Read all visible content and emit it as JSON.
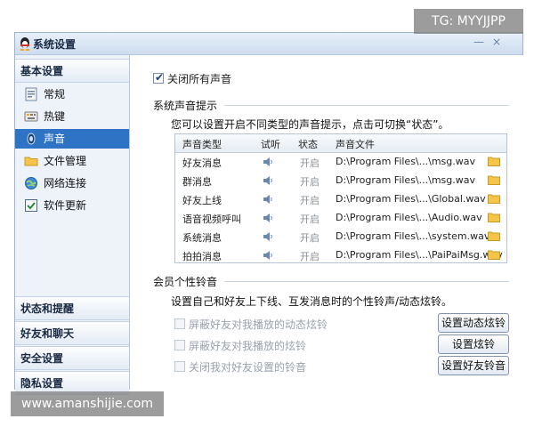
{
  "window": {
    "title": "系统设置"
  },
  "sidebar": {
    "sections": [
      {
        "label": "基本设置"
      },
      {
        "label": "状态和提醒"
      },
      {
        "label": "好友和聊天"
      },
      {
        "label": "安全设置"
      },
      {
        "label": "隐私设置"
      }
    ],
    "items": [
      {
        "label": "常规",
        "icon": "general-icon"
      },
      {
        "label": "热键",
        "icon": "hotkey-icon"
      },
      {
        "label": "声音",
        "icon": "sound-icon",
        "selected": true
      },
      {
        "label": "文件管理",
        "icon": "folder-icon"
      },
      {
        "label": "网络连接",
        "icon": "network-icon"
      },
      {
        "label": "软件更新",
        "icon": "update-icon"
      }
    ]
  },
  "content": {
    "mute_all": {
      "label": "关闭所有声音",
      "checked": true
    },
    "system_group": {
      "title": "系统声音提示",
      "description": "您可以设置开启不同类型的声音提示，点击可切换“状态”。"
    },
    "table": {
      "headers": [
        "声音类型",
        "试听",
        "状态",
        "声音文件"
      ],
      "rows": [
        {
          "type": "好友消息",
          "status": "开启",
          "file": "D:\\Program Files\\...\\msg.wav"
        },
        {
          "type": "群消息",
          "status": "开启",
          "file": "D:\\Program Files\\...\\msg.wav"
        },
        {
          "type": "好友上线",
          "status": "开启",
          "file": "D:\\Program Files\\...\\Global.wav"
        },
        {
          "type": "语音视频呼叫",
          "status": "开启",
          "file": "D:\\Program Files\\...\\Audio.wav"
        },
        {
          "type": "系统消息",
          "status": "开启",
          "file": "D:\\Program Files\\...\\system.wav"
        },
        {
          "type": "拍拍消息",
          "status": "开启",
          "file": "D:\\Program Files\\...\\PaiPaiMsg.wav"
        }
      ]
    },
    "member_group": {
      "title": "会员个性铃音",
      "description": "设置自己和好友上下线、互发消息时的个性铃声/动态炫铃。",
      "options": [
        {
          "label": "屏蔽好友对我播放的动态炫铃",
          "button": "设置动态炫铃"
        },
        {
          "label": "屏蔽好友对我播放的炫铃",
          "button": "设置炫铃"
        },
        {
          "label": "关闭我对好友设置的铃音",
          "button": "设置好友铃音"
        }
      ]
    }
  },
  "watermarks": {
    "top": "TG: MYYJJPP",
    "bottom": "www.amanshijie.com"
  },
  "colors": {
    "selected": "#2f73c4",
    "accent_border": "#9db3cf"
  }
}
